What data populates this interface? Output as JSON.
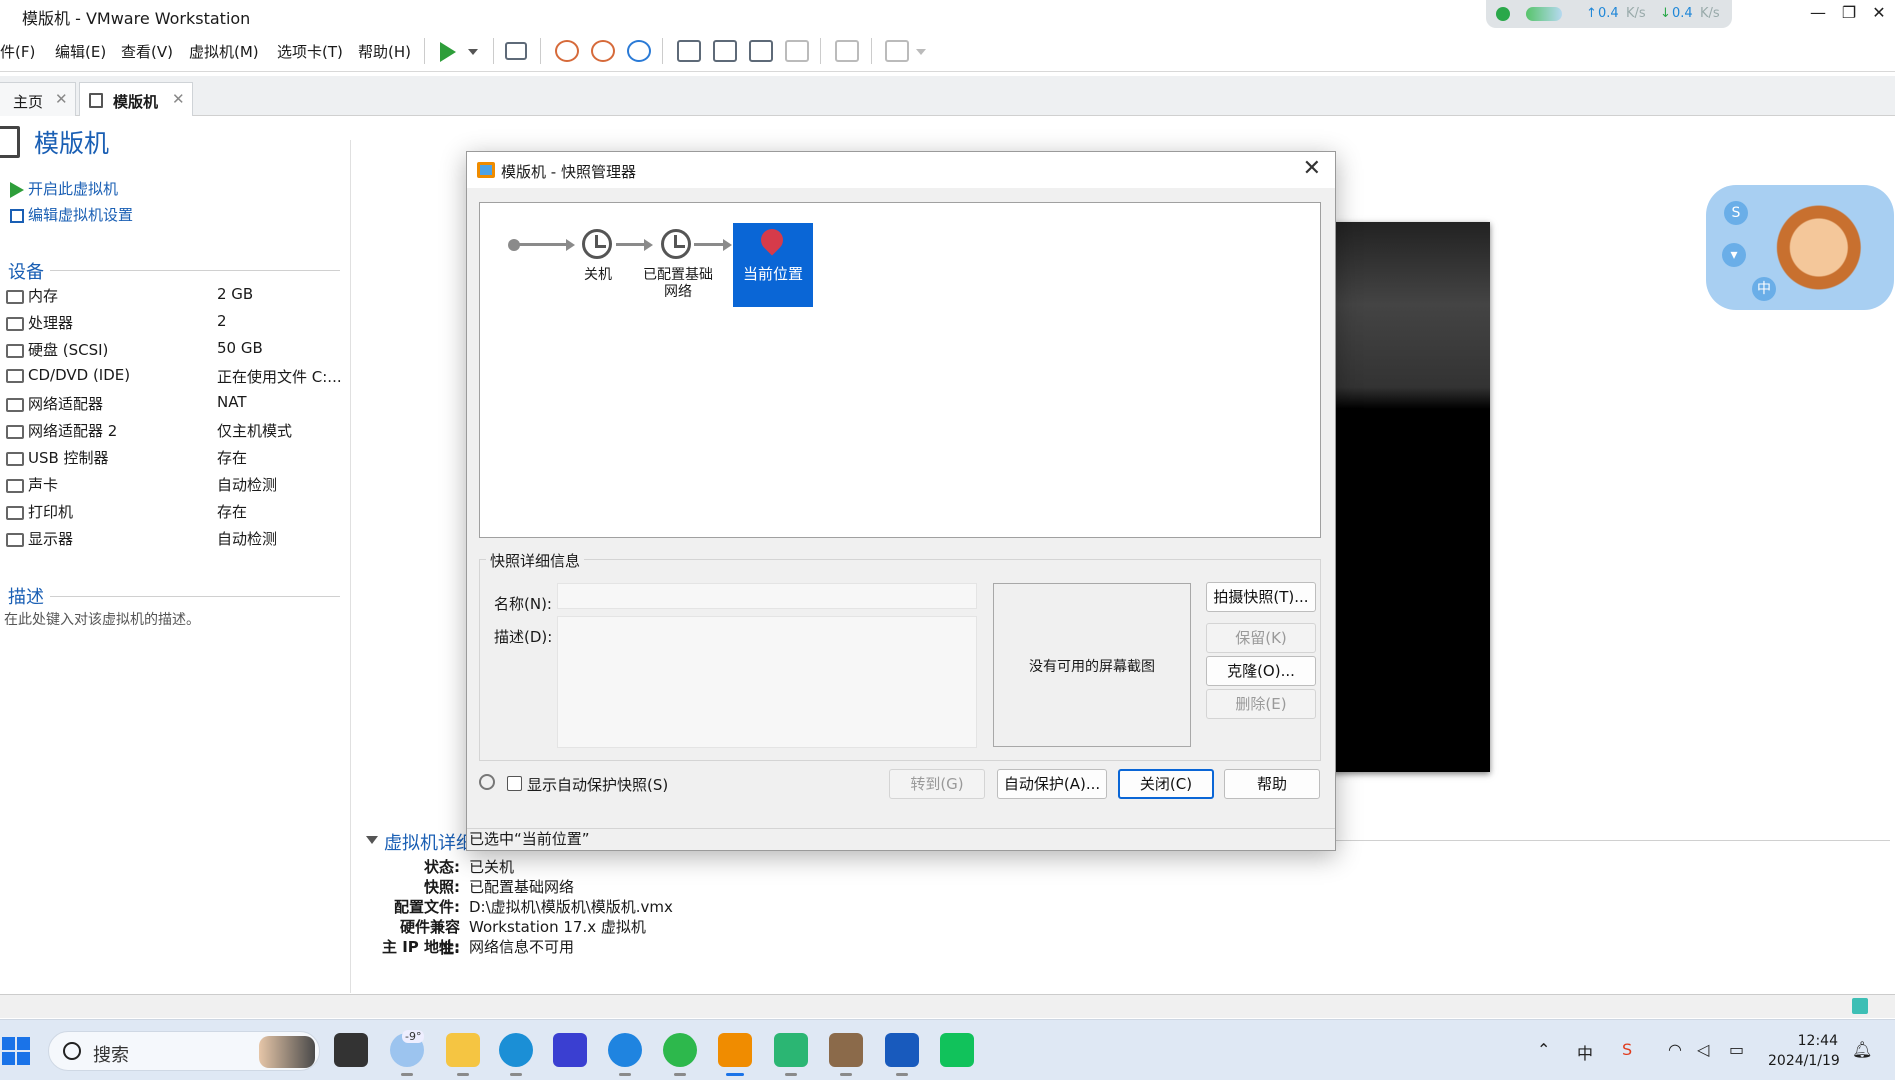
{
  "window": {
    "title": "模版机 - VMware Workstation",
    "minimize": "—",
    "restore": "❐",
    "close": "✕"
  },
  "netmonitor": {
    "up": "0.4",
    "up_unit": "K/s",
    "down": "0.4",
    "down_unit": "K/s"
  },
  "menu": [
    "文件(F)",
    "编辑(E)",
    "查看(V)",
    "虚拟机(M)",
    "选项卡(T)",
    "帮助(H)"
  ],
  "menu_visible": [
    "件(F)",
    "编辑(E)",
    "查看(V)",
    "虚拟机(M)",
    "选项卡(T)",
    "帮助(H)"
  ],
  "tabs": [
    {
      "label": "主页",
      "close": "✕"
    },
    {
      "label": "模版机",
      "close": "✕"
    }
  ],
  "vm": {
    "name": "模版机",
    "actions": [
      "开启此虚拟机",
      "编辑虚拟机设置"
    ],
    "devices_heading": "设备",
    "devices": [
      {
        "name": "内存",
        "value": "2 GB"
      },
      {
        "name": "处理器",
        "value": "2"
      },
      {
        "name": "硬盘 (SCSI)",
        "value": "50 GB"
      },
      {
        "name": "CD/DVD (IDE)",
        "value": "正在使用文件 C:..."
      },
      {
        "name": "网络适配器",
        "value": "NAT"
      },
      {
        "name": "网络适配器 2",
        "value": "仅主机模式"
      },
      {
        "name": "USB 控制器",
        "value": "存在"
      },
      {
        "name": "声卡",
        "value": "自动检测"
      },
      {
        "name": "打印机",
        "value": "存在"
      },
      {
        "name": "显示器",
        "value": "自动检测"
      }
    ],
    "desc_heading": "描述",
    "desc_placeholder": "在此处键入对该虚拟机的描述。"
  },
  "vm_details": {
    "heading": "虚拟机详细信息",
    "rows": [
      {
        "key": "状态:",
        "value": "已关机"
      },
      {
        "key": "快照:",
        "value": "已配置基础网络"
      },
      {
        "key": "配置文件:",
        "value": "D:\\虚拟机\\模版机\\模版机.vmx"
      },
      {
        "key": "硬件兼容性:",
        "value": "Workstation 17.x 虚拟机"
      },
      {
        "key": "主 IP 地址:",
        "value": "网络信息不可用"
      }
    ]
  },
  "dialog": {
    "title": "模版机 - 快照管理器",
    "snapshots": [
      {
        "label": "关机"
      },
      {
        "label": "已配置基础网络"
      },
      {
        "label": "当前位置",
        "selected": true
      }
    ],
    "details_group": "快照详细信息",
    "name_label": "名称(N):",
    "desc_label": "描述(D):",
    "no_screenshot": "没有可用的屏幕截图",
    "buttons": {
      "take": "拍摄快照(T)...",
      "keep": "保留(K)",
      "clone": "克隆(O)...",
      "delete": "删除(E)",
      "goto": "转到(G)",
      "autoprotect": "自动保护(A)...",
      "close": "关闭(C)",
      "help": "帮助"
    },
    "show_autoprotect": "显示自动保护快照(S)",
    "status": "已选中“当前位置”"
  },
  "taskbar": {
    "search_text": "搜索",
    "weather": "-9°",
    "time": "12:44",
    "date": "2024/1/19",
    "ime": "中",
    "apps": [
      "file-explorer",
      "edge",
      "vscode-like",
      "kugou",
      "wechat",
      "vmware",
      "terminal",
      "photos",
      "word",
      "iqiyi"
    ]
  },
  "colors": {
    "accent": "#0a66d6",
    "link": "#1a5fb4",
    "snapshot_pin": "#d63b4a"
  }
}
